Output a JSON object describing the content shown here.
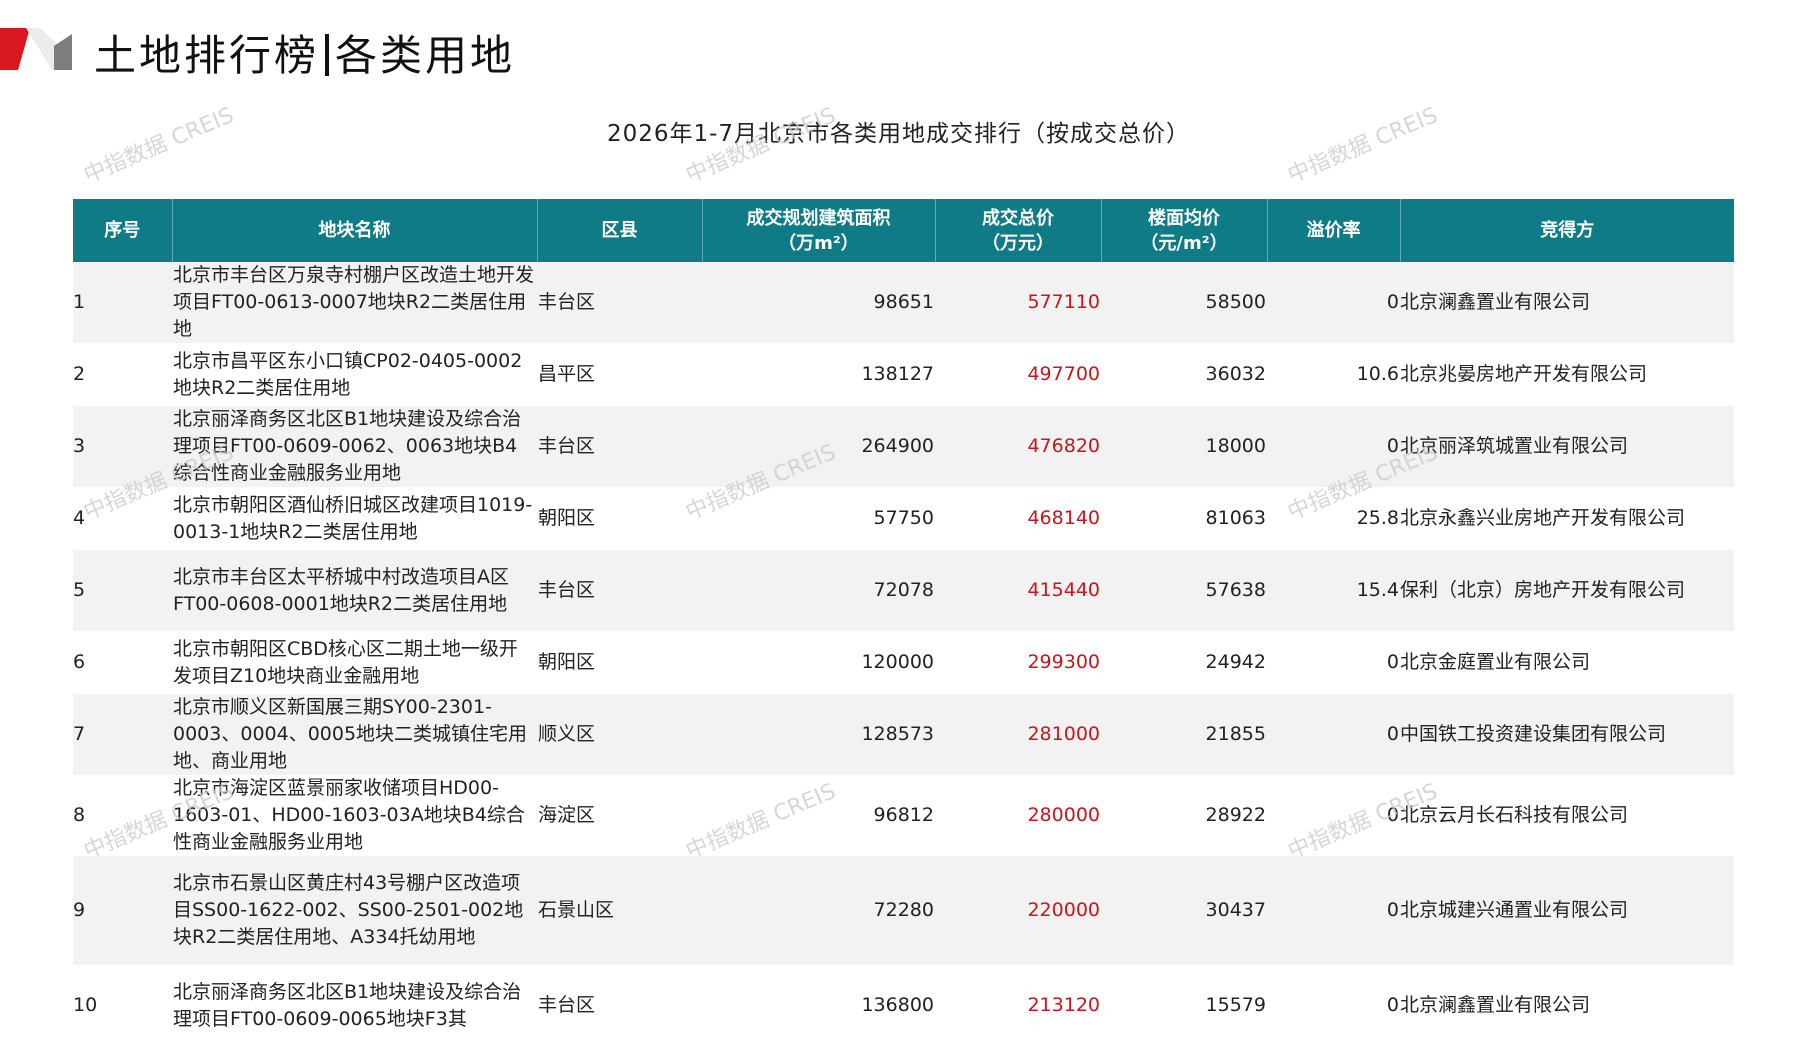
{
  "header": {
    "title_left": "土地排行榜",
    "title_right": "各类用地",
    "report_title": "2026年1-7月北京市各类用地成交排行（按成交总价）"
  },
  "watermark": "中指数据 CREIS",
  "colors": {
    "header_bg": "#0e7b86",
    "price": "#c8161d",
    "logo_red": "#d7191f",
    "logo_gray": "#7d7d7d"
  },
  "table": {
    "columns": [
      {
        "label": "序号"
      },
      {
        "label": "地块名称"
      },
      {
        "label": "区县"
      },
      {
        "label": "成交规划建筑面积",
        "unit": "（万m²）"
      },
      {
        "label": "成交总价",
        "unit": "（万元）"
      },
      {
        "label": "楼面均价",
        "unit": "（元/m²）"
      },
      {
        "label": "溢价率"
      },
      {
        "label": "竞得方"
      }
    ],
    "rows": [
      {
        "rank": "1",
        "name": "北京市丰台区万泉寺村棚户区改造土地开发项目FT00-0613-0007地块R2二类居住用地",
        "district": "丰台区",
        "area": "98651",
        "total": "577110",
        "unit_price": "58500",
        "premium": "0",
        "buyer": "北京澜鑫置业有限公司"
      },
      {
        "rank": "2",
        "name": "北京市昌平区东小口镇CP02-0405-0002地块R2二类居住用地",
        "district": "昌平区",
        "area": "138127",
        "total": "497700",
        "unit_price": "36032",
        "premium": "10.6",
        "buyer": "北京兆晏房地产开发有限公司"
      },
      {
        "rank": "3",
        "name": "北京丽泽商务区北区B1地块建设及综合治理项目FT00-0609-0062、0063地块B4综合性商业金融服务业用地",
        "district": "丰台区",
        "area": "264900",
        "total": "476820",
        "unit_price": "18000",
        "premium": "0",
        "buyer": "北京丽泽筑城置业有限公司"
      },
      {
        "rank": "4",
        "name": "北京市朝阳区酒仙桥旧城区改建项目1019-0013-1地块R2二类居住用地",
        "district": "朝阳区",
        "area": "57750",
        "total": "468140",
        "unit_price": "81063",
        "premium": "25.8",
        "buyer": "北京永鑫兴业房地产开发有限公司"
      },
      {
        "rank": "5",
        "name": "北京市丰台区太平桥城中村改造项目A区FT00-0608-0001地块R2二类居住用地",
        "district": "丰台区",
        "area": "72078",
        "total": "415440",
        "unit_price": "57638",
        "premium": "15.4",
        "buyer": "保利（北京）房地产开发有限公司"
      },
      {
        "rank": "6",
        "name": "北京市朝阳区CBD核心区二期土地一级开发项目Z10地块商业金融用地",
        "district": "朝阳区",
        "area": "120000",
        "total": "299300",
        "unit_price": "24942",
        "premium": "0",
        "buyer": "北京金庭置业有限公司"
      },
      {
        "rank": "7",
        "name": "北京市顺义区新国展三期SY00-2301-0003、0004、0005地块二类城镇住宅用地、商业用地",
        "district": "顺义区",
        "area": "128573",
        "total": "281000",
        "unit_price": "21855",
        "premium": "0",
        "buyer": "中国铁工投资建设集团有限公司"
      },
      {
        "rank": "8",
        "name": "北京市海淀区蓝景丽家收储项目HD00-1603-01、HD00-1603-03A地块B4综合性商业金融服务业用地",
        "district": "海淀区",
        "area": "96812",
        "total": "280000",
        "unit_price": "28922",
        "premium": "0",
        "buyer": "北京云月长石科技有限公司"
      },
      {
        "rank": "9",
        "name": "北京市石景山区黄庄村43号棚户区改造项目SS00-1622-002、SS00-2501-002地块R2二类居住用地、A334托幼用地",
        "district": "石景山区",
        "area": "72280",
        "total": "220000",
        "unit_price": "30437",
        "premium": "0",
        "buyer": "北京城建兴通置业有限公司"
      },
      {
        "rank": "10",
        "name": "北京丽泽商务区北区B1地块建设及综合治理项目FT00-0609-0065地块F3其",
        "district": "丰台区",
        "area": "136800",
        "total": "213120",
        "unit_price": "15579",
        "premium": "0",
        "buyer": "北京澜鑫置业有限公司"
      }
    ]
  }
}
